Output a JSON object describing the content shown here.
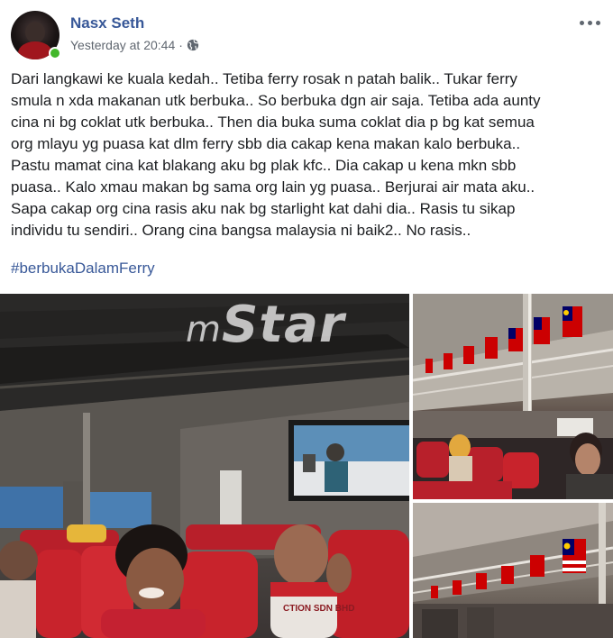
{
  "post": {
    "author": "Nasx Seth",
    "timestamp": "Yesterday at 20:44",
    "separator": "·",
    "privacy_icon": "globe-icon",
    "more_icon": "more-options-icon",
    "body_lines": [
      "Dari langkawi ke kuala kedah.. Tetiba ferry rosak n patah balik.. Tukar ferry",
      "smula n xda makanan utk berbuka.. So berbuka dgn air saja. Tetiba ada aunty",
      "cina ni bg coklat utk berbuka.. Then dia buka suma coklat dia p bg kat semua",
      "org mlayu yg puasa kat dlm ferry sbb dia cakap kena makan kalo berbuka..",
      "Pastu mamat cina kat blakang aku bg plak kfc.. Dia cakap u kena mkn sbb",
      "puasa.. Kalo xmau makan bg sama org lain yg puasa.. Berjurai air mata aku..",
      "Sapa cakap org cina rasis aku nak bg starlight kat dahi dia.. Rasis tu sikap",
      "individu tu sendiri.. Orang cina bangsa malaysia ni baik2.. No rasis.."
    ],
    "hashtag": "#berbukaDalamFerry"
  },
  "photos": {
    "watermark_prefix": "m",
    "watermark_main": "Star",
    "shirt_text": "CTION SDN BHD"
  },
  "colors": {
    "author": "#385898",
    "link": "#385898",
    "meta": "#606770",
    "online": "#42b72a",
    "seat_red": "#c8232c",
    "flag_red": "#cc0001",
    "flag_blue": "#010066",
    "flag_yellow": "#ffcc00"
  }
}
